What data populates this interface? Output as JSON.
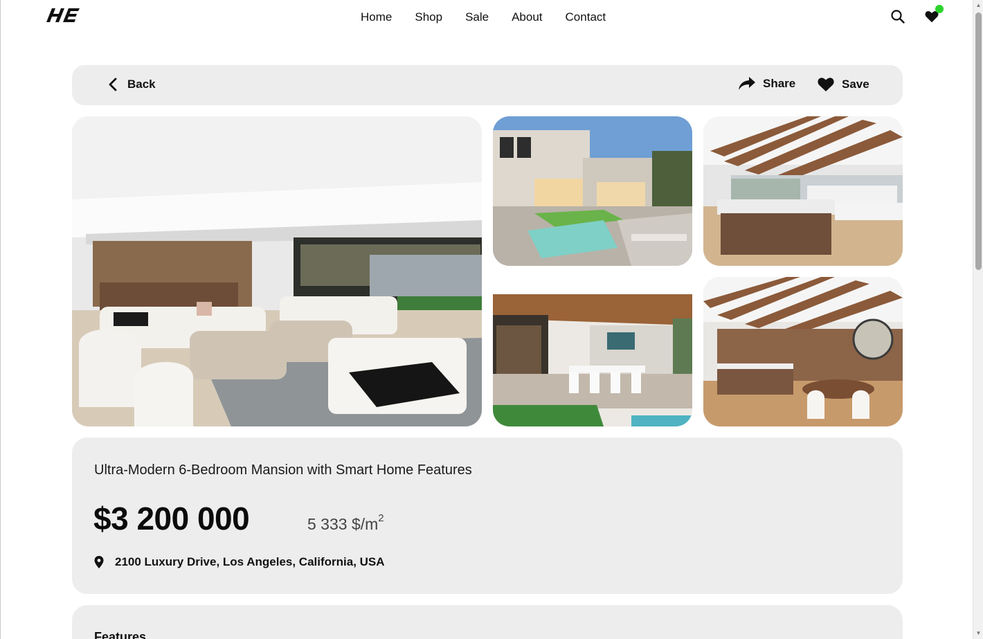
{
  "nav": {
    "links": [
      "Home",
      "Shop",
      "Sale",
      "About",
      "Contact"
    ]
  },
  "toolbar": {
    "back_label": "Back",
    "share_label": "Share",
    "save_label": "Save"
  },
  "gallery": {
    "photos": [
      "living-room",
      "exterior-pool",
      "kitchen-beams",
      "patio-dining",
      "kitchen-dining"
    ]
  },
  "listing": {
    "title": "Ultra-Modern 6-Bedroom Mansion with Smart Home Features",
    "price": "$3 200 000",
    "price_per_unit": "5 333 $/m",
    "price_per_unit_exp": "2",
    "address": "2100 Luxury Drive, Los Angeles, California, USA"
  },
  "features": {
    "heading": "Features"
  },
  "colors": {
    "card_bg": "#ededed",
    "notification_dot": "#2bd42b"
  }
}
